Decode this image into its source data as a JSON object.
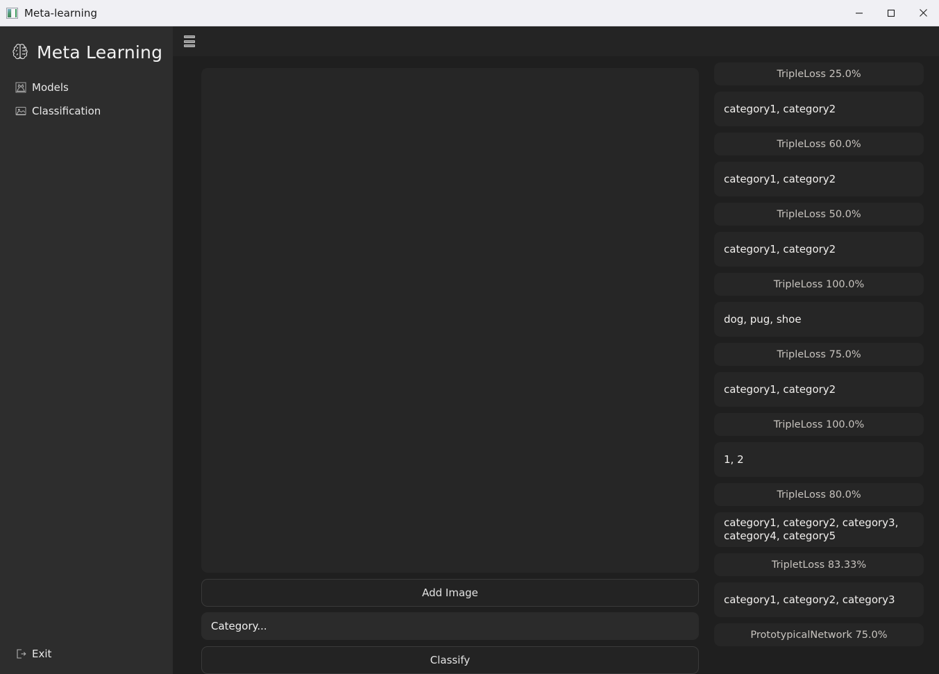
{
  "window": {
    "title": "Meta-learning",
    "icon": "image-app-icon",
    "controls": {
      "minimize_label": "Minimize",
      "maximize_label": "Maximize",
      "close_label": "Close"
    }
  },
  "sidebar": {
    "brand": {
      "label": "Meta Learning",
      "icon": "brain-icon"
    },
    "items": [
      {
        "label": "Models",
        "icon": "models-icon"
      },
      {
        "label": "Classification",
        "icon": "classification-icon"
      }
    ],
    "footer": {
      "label": "Exit",
      "icon": "exit-icon"
    }
  },
  "topbar": {
    "menu_icon": "stacked-list-icon"
  },
  "main": {
    "image_drop": {
      "label": ""
    },
    "add_image_button": "Add Image",
    "category_input": {
      "value": "",
      "placeholder": "Category..."
    },
    "classify_button": "Classify"
  },
  "results": [
    {
      "header": "TripleLoss 25.0%",
      "categories": "category1, category2"
    },
    {
      "header": "TripleLoss 60.0%",
      "categories": "category1, category2"
    },
    {
      "header": "TripleLoss 50.0%",
      "categories": "category1, category2"
    },
    {
      "header": "TripleLoss 100.0%",
      "categories": "dog, pug, shoe"
    },
    {
      "header": "TripleLoss 75.0%",
      "categories": "category1, category2"
    },
    {
      "header": "TripleLoss 100.0%",
      "categories": "1, 2"
    },
    {
      "header": "TripleLoss 80.0%",
      "categories": "category1, category2, category3, category4, category5"
    },
    {
      "header": "TripletLoss 83.33%",
      "categories": "category1, category2, category3"
    },
    {
      "header": "PrototypicalNetwork 75.0%",
      "categories": ""
    }
  ],
  "colors": {
    "titlebar_bg": "#f0f0f4",
    "sidebar_bg": "#2d2d2d",
    "content_bg": "#1f1f1f",
    "panel_bg": "#262626",
    "text_primary": "#f2f0ee",
    "text_muted": "#c8c4bf"
  }
}
